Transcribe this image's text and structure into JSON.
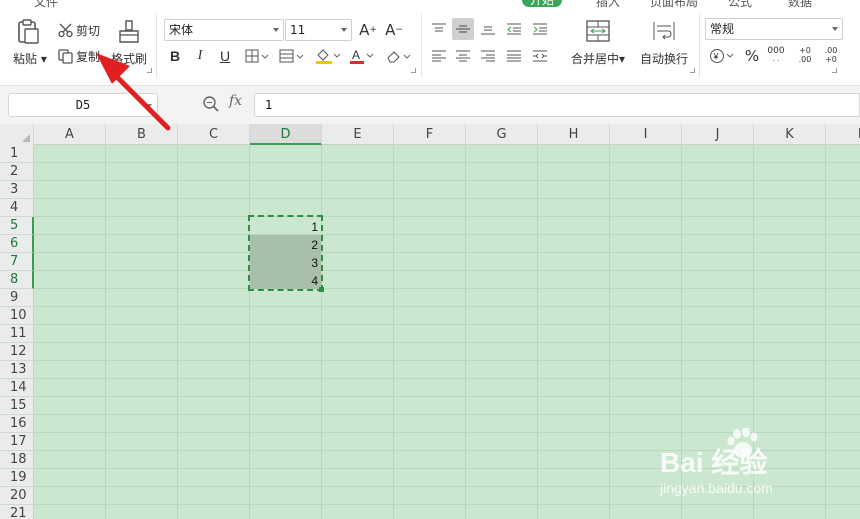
{
  "menu_tabs": [
    {
      "label": "文件",
      "active": false
    },
    {
      "label": "开始",
      "active": true
    },
    {
      "label": "插入",
      "active": false
    },
    {
      "label": "页面布局",
      "active": false
    },
    {
      "label": "公式",
      "active": false
    },
    {
      "label": "数据",
      "active": false
    }
  ],
  "ribbon": {
    "paste_label": "粘贴",
    "cut_label": "剪切",
    "copy_label": "复制",
    "format_painter_label": "格式刷",
    "font_name": "宋体",
    "font_size": "11",
    "bold": "B",
    "italic": "I",
    "underline": "U",
    "merge_label": "合并居中",
    "wrap_label": "自动换行",
    "number_format": "常规",
    "percent": "%",
    "thousands": "000",
    "inc_decimal": "+0 .00",
    "dec_decimal": ".00 +0"
  },
  "formula_bar": {
    "name_box": "D5",
    "fx": "fx",
    "formula": "1"
  },
  "columns": [
    "A",
    "B",
    "C",
    "D",
    "E",
    "F",
    "G",
    "H",
    "I",
    "J",
    "K",
    "L"
  ],
  "selected_column": "D",
  "rows": [
    "1",
    "2",
    "3",
    "4",
    "5",
    "6",
    "7",
    "8",
    "9",
    "10",
    "11",
    "12",
    "13",
    "14",
    "15",
    "16",
    "17",
    "18",
    "19",
    "20",
    "21"
  ],
  "selected_rows": [
    "5",
    "6",
    "7",
    "8"
  ],
  "cells": [
    {
      "ref": "D5",
      "value": "1"
    },
    {
      "ref": "D6",
      "value": "2"
    },
    {
      "ref": "D7",
      "value": "3"
    },
    {
      "ref": "D8",
      "value": "4"
    }
  ],
  "watermark": {
    "brand": "Bai  经验",
    "url": "jingyan.baidu.com"
  },
  "colors": {
    "accent": "#3aa65a",
    "grid_bg": "#cce7cf",
    "selection": "#2c8f45",
    "arrow": "#e02020"
  }
}
